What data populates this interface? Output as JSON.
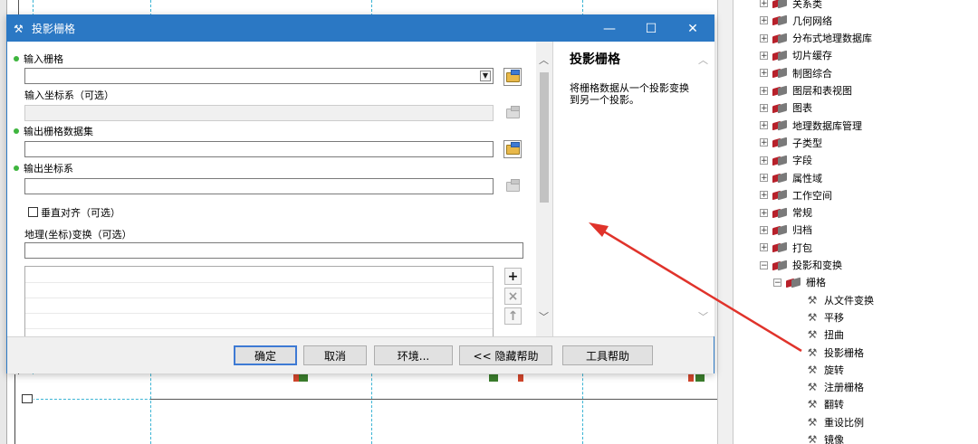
{
  "dialog": {
    "title": "投影栅格",
    "controls": {
      "minimize": "—",
      "maximize": "☐",
      "close": "✕"
    },
    "fields": {
      "input_raster_label": "输入栅格",
      "input_raster_value": "",
      "input_coord_label": "输入坐标系（可选）",
      "input_coord_value": "",
      "output_dataset_label": "输出栅格数据集",
      "output_dataset_value": "",
      "output_coord_label": "输出坐标系",
      "output_coord_value": "",
      "vertical_align_label": "垂直对齐（可选）",
      "vertical_align_checked": false,
      "geo_transform_label": "地理(坐标)变换（可选）",
      "geo_transform_value": ""
    },
    "list_side_buttons": {
      "add": "+",
      "remove": "×",
      "up": "↑"
    },
    "help": {
      "title": "投影栅格",
      "body": "将栅格数据从一个投影变换到另一个投影。"
    },
    "buttons": {
      "ok": "确定",
      "cancel": "取消",
      "environments": "环境...",
      "hide_help": "<< 隐藏帮助",
      "tool_help": "工具帮助"
    }
  },
  "catalog": {
    "items": [
      {
        "label": "关系类",
        "type": "toolset",
        "expander": "⊞"
      },
      {
        "label": "几何网络",
        "type": "toolset",
        "expander": "⊞"
      },
      {
        "label": "分布式地理数据库",
        "type": "toolset",
        "expander": "⊞"
      },
      {
        "label": "切片缓存",
        "type": "toolset",
        "expander": "⊞"
      },
      {
        "label": "制图综合",
        "type": "toolset",
        "expander": "⊞"
      },
      {
        "label": "图层和表视图",
        "type": "toolset",
        "expander": "⊞"
      },
      {
        "label": "图表",
        "type": "toolset",
        "expander": "⊞"
      },
      {
        "label": "地理数据库管理",
        "type": "toolset",
        "expander": "⊞"
      },
      {
        "label": "子类型",
        "type": "toolset",
        "expander": "⊞"
      },
      {
        "label": "字段",
        "type": "toolset",
        "expander": "⊞"
      },
      {
        "label": "属性域",
        "type": "toolset",
        "expander": "⊞"
      },
      {
        "label": "工作空间",
        "type": "toolset",
        "expander": "⊞"
      },
      {
        "label": "常规",
        "type": "toolset",
        "expander": "⊞"
      },
      {
        "label": "归档",
        "type": "toolset",
        "expander": "⊞"
      },
      {
        "label": "打包",
        "type": "toolset",
        "expander": "⊞"
      },
      {
        "label": "投影和变换",
        "type": "toolset",
        "expander": "⊟"
      },
      {
        "label": "栅格",
        "type": "toolset",
        "expander": "⊟",
        "indent": 1
      },
      {
        "label": "从文件变换",
        "type": "tool",
        "indent": 2
      },
      {
        "label": "平移",
        "type": "tool",
        "indent": 2
      },
      {
        "label": "扭曲",
        "type": "tool",
        "indent": 2
      },
      {
        "label": "投影栅格",
        "type": "tool",
        "indent": 2
      },
      {
        "label": "旋转",
        "type": "tool",
        "indent": 2
      },
      {
        "label": "注册栅格",
        "type": "tool",
        "indent": 2
      },
      {
        "label": "翻转",
        "type": "tool",
        "indent": 2
      },
      {
        "label": "重设比例",
        "type": "tool",
        "indent": 2
      },
      {
        "label": "镜像",
        "type": "tool",
        "indent": 2
      }
    ]
  },
  "colors": {
    "title_bar": "#2b78c4",
    "annotation_arrow": "#e0332b",
    "required_marker": "#3eb53e"
  }
}
